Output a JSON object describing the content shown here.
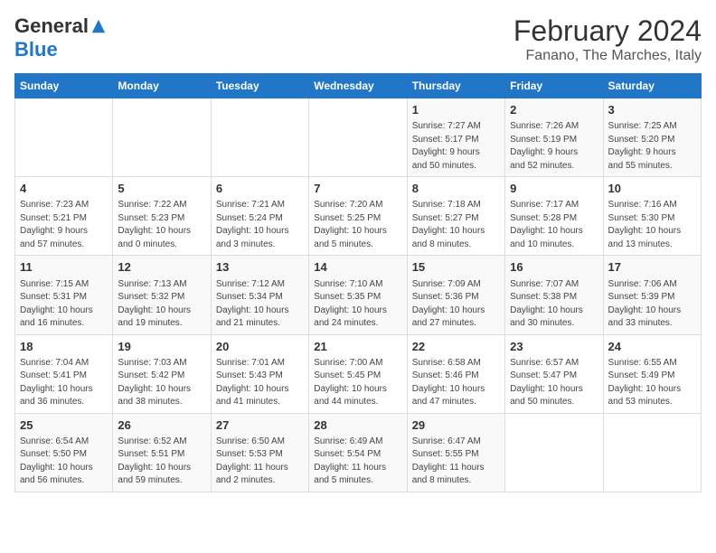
{
  "header": {
    "logo_general": "General",
    "logo_blue": "Blue",
    "month_title": "February 2024",
    "location": "Fanano, The Marches, Italy"
  },
  "calendar": {
    "days_of_week": [
      "Sunday",
      "Monday",
      "Tuesday",
      "Wednesday",
      "Thursday",
      "Friday",
      "Saturday"
    ],
    "weeks": [
      [
        {
          "day": "",
          "info": ""
        },
        {
          "day": "",
          "info": ""
        },
        {
          "day": "",
          "info": ""
        },
        {
          "day": "",
          "info": ""
        },
        {
          "day": "1",
          "info": "Sunrise: 7:27 AM\nSunset: 5:17 PM\nDaylight: 9 hours\nand 50 minutes."
        },
        {
          "day": "2",
          "info": "Sunrise: 7:26 AM\nSunset: 5:19 PM\nDaylight: 9 hours\nand 52 minutes."
        },
        {
          "day": "3",
          "info": "Sunrise: 7:25 AM\nSunset: 5:20 PM\nDaylight: 9 hours\nand 55 minutes."
        }
      ],
      [
        {
          "day": "4",
          "info": "Sunrise: 7:23 AM\nSunset: 5:21 PM\nDaylight: 9 hours\nand 57 minutes."
        },
        {
          "day": "5",
          "info": "Sunrise: 7:22 AM\nSunset: 5:23 PM\nDaylight: 10 hours\nand 0 minutes."
        },
        {
          "day": "6",
          "info": "Sunrise: 7:21 AM\nSunset: 5:24 PM\nDaylight: 10 hours\nand 3 minutes."
        },
        {
          "day": "7",
          "info": "Sunrise: 7:20 AM\nSunset: 5:25 PM\nDaylight: 10 hours\nand 5 minutes."
        },
        {
          "day": "8",
          "info": "Sunrise: 7:18 AM\nSunset: 5:27 PM\nDaylight: 10 hours\nand 8 minutes."
        },
        {
          "day": "9",
          "info": "Sunrise: 7:17 AM\nSunset: 5:28 PM\nDaylight: 10 hours\nand 10 minutes."
        },
        {
          "day": "10",
          "info": "Sunrise: 7:16 AM\nSunset: 5:30 PM\nDaylight: 10 hours\nand 13 minutes."
        }
      ],
      [
        {
          "day": "11",
          "info": "Sunrise: 7:15 AM\nSunset: 5:31 PM\nDaylight: 10 hours\nand 16 minutes."
        },
        {
          "day": "12",
          "info": "Sunrise: 7:13 AM\nSunset: 5:32 PM\nDaylight: 10 hours\nand 19 minutes."
        },
        {
          "day": "13",
          "info": "Sunrise: 7:12 AM\nSunset: 5:34 PM\nDaylight: 10 hours\nand 21 minutes."
        },
        {
          "day": "14",
          "info": "Sunrise: 7:10 AM\nSunset: 5:35 PM\nDaylight: 10 hours\nand 24 minutes."
        },
        {
          "day": "15",
          "info": "Sunrise: 7:09 AM\nSunset: 5:36 PM\nDaylight: 10 hours\nand 27 minutes."
        },
        {
          "day": "16",
          "info": "Sunrise: 7:07 AM\nSunset: 5:38 PM\nDaylight: 10 hours\nand 30 minutes."
        },
        {
          "day": "17",
          "info": "Sunrise: 7:06 AM\nSunset: 5:39 PM\nDaylight: 10 hours\nand 33 minutes."
        }
      ],
      [
        {
          "day": "18",
          "info": "Sunrise: 7:04 AM\nSunset: 5:41 PM\nDaylight: 10 hours\nand 36 minutes."
        },
        {
          "day": "19",
          "info": "Sunrise: 7:03 AM\nSunset: 5:42 PM\nDaylight: 10 hours\nand 38 minutes."
        },
        {
          "day": "20",
          "info": "Sunrise: 7:01 AM\nSunset: 5:43 PM\nDaylight: 10 hours\nand 41 minutes."
        },
        {
          "day": "21",
          "info": "Sunrise: 7:00 AM\nSunset: 5:45 PM\nDaylight: 10 hours\nand 44 minutes."
        },
        {
          "day": "22",
          "info": "Sunrise: 6:58 AM\nSunset: 5:46 PM\nDaylight: 10 hours\nand 47 minutes."
        },
        {
          "day": "23",
          "info": "Sunrise: 6:57 AM\nSunset: 5:47 PM\nDaylight: 10 hours\nand 50 minutes."
        },
        {
          "day": "24",
          "info": "Sunrise: 6:55 AM\nSunset: 5:49 PM\nDaylight: 10 hours\nand 53 minutes."
        }
      ],
      [
        {
          "day": "25",
          "info": "Sunrise: 6:54 AM\nSunset: 5:50 PM\nDaylight: 10 hours\nand 56 minutes."
        },
        {
          "day": "26",
          "info": "Sunrise: 6:52 AM\nSunset: 5:51 PM\nDaylight: 10 hours\nand 59 minutes."
        },
        {
          "day": "27",
          "info": "Sunrise: 6:50 AM\nSunset: 5:53 PM\nDaylight: 11 hours\nand 2 minutes."
        },
        {
          "day": "28",
          "info": "Sunrise: 6:49 AM\nSunset: 5:54 PM\nDaylight: 11 hours\nand 5 minutes."
        },
        {
          "day": "29",
          "info": "Sunrise: 6:47 AM\nSunset: 5:55 PM\nDaylight: 11 hours\nand 8 minutes."
        },
        {
          "day": "",
          "info": ""
        },
        {
          "day": "",
          "info": ""
        }
      ]
    ]
  }
}
